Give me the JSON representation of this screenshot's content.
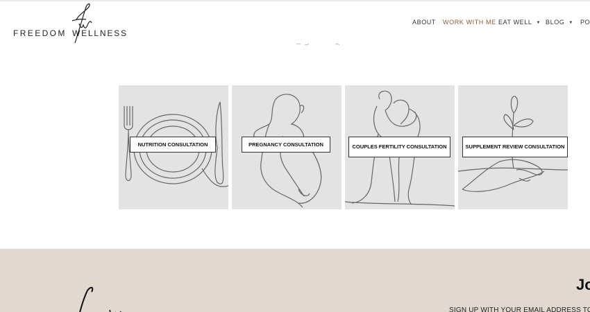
{
  "brand": {
    "monogram": "fw",
    "name_left": "FREEDOM",
    "name_right": "WELLNESS"
  },
  "nav": {
    "items": [
      {
        "label": "ABOUT",
        "dropdown": false,
        "active": false
      },
      {
        "label": "WORK WITH ME",
        "dropdown": false,
        "active": true
      },
      {
        "label": "EAT WELL",
        "dropdown": true,
        "active": false
      },
      {
        "label": "BLOG",
        "dropdown": true,
        "active": false
      },
      {
        "label": "POD",
        "dropdown": false,
        "active": false
      }
    ],
    "caret_glyph": "▼"
  },
  "cards": [
    {
      "label": "NUTRITION CONSULTATION",
      "icon": "plate-cutlery-icon"
    },
    {
      "label": "PREGNANCY CONSULTATION",
      "icon": "pregnant-woman-icon"
    },
    {
      "label": "COUPLES FERTILITY CONSULTATION",
      "icon": "couple-embrace-icon"
    },
    {
      "label": "SUPPLEMENT REVIEW CONSULTATION",
      "icon": "hand-sprout-icon"
    }
  ],
  "footer": {
    "join_text": "Jo",
    "signup_text": "SIGN UP WITH YOUR EMAIL ADDRESS TO R"
  },
  "colors": {
    "accent": "#8a5a3c",
    "card_bg": "#e3e3e3",
    "footer_bg": "#e1d8cf"
  }
}
